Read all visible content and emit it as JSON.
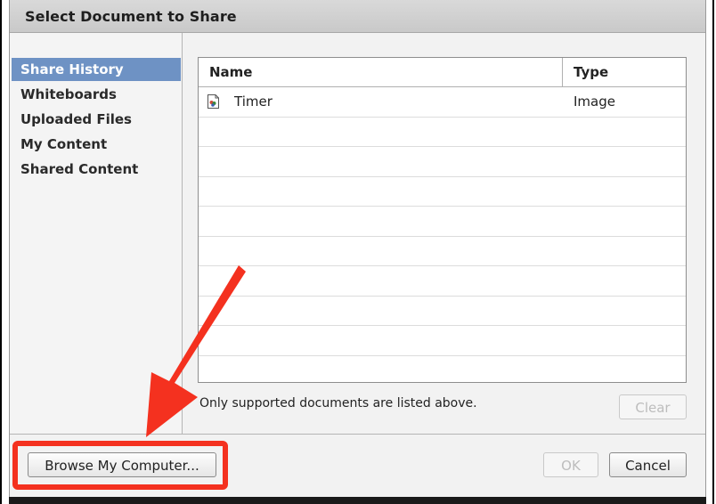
{
  "dialog": {
    "title": "Select Document to Share"
  },
  "sidebar": {
    "items": [
      {
        "label": "Share History",
        "selected": true
      },
      {
        "label": "Whiteboards",
        "selected": false
      },
      {
        "label": "Uploaded Files",
        "selected": false
      },
      {
        "label": "My Content",
        "selected": false
      },
      {
        "label": "Shared Content",
        "selected": false
      }
    ]
  },
  "filelist": {
    "columns": [
      "Name",
      "Type"
    ],
    "rows": [
      {
        "name": "Timer",
        "type": "Image",
        "icon": "image-file-icon"
      }
    ]
  },
  "note": "Only supported documents are listed above.",
  "buttons": {
    "clear": "Clear",
    "browse": "Browse My Computer...",
    "ok": "OK",
    "cancel": "Cancel"
  },
  "colors": {
    "selected_bg": "#6e92c4",
    "annotation": "#f4311f"
  }
}
